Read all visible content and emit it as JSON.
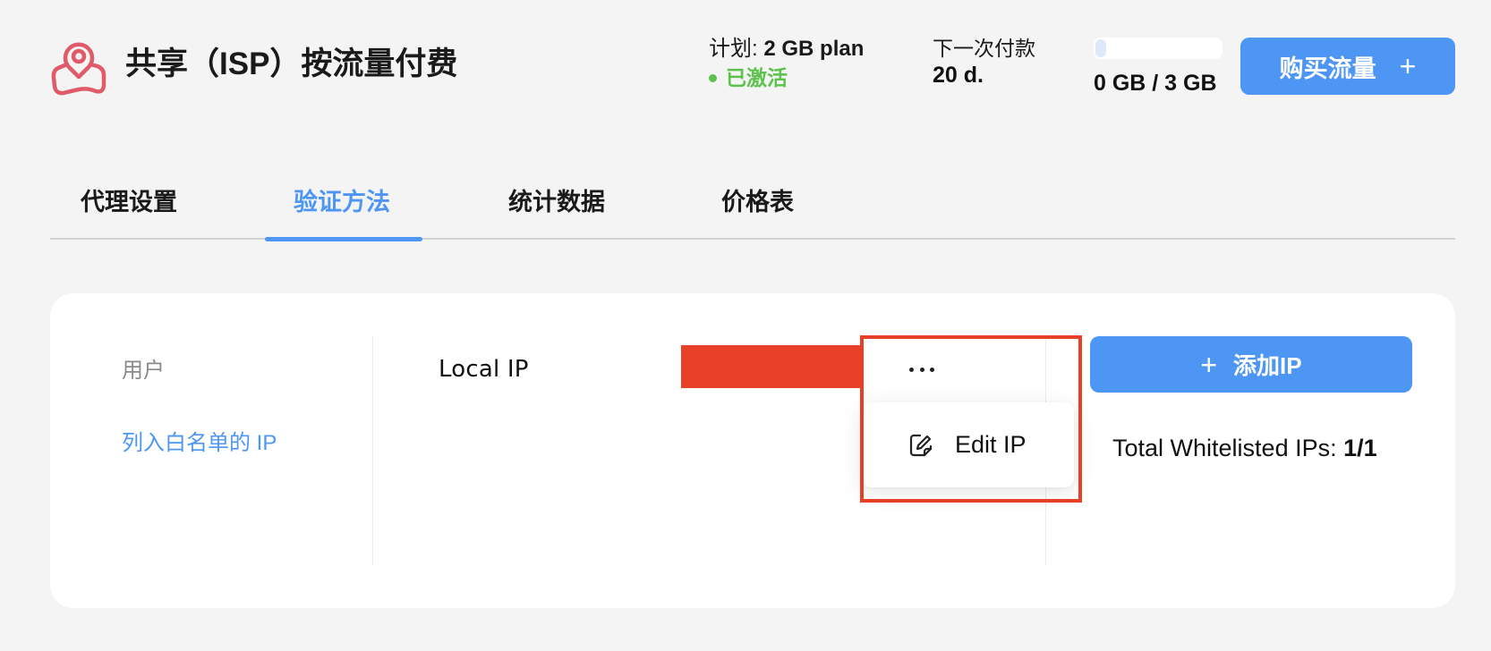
{
  "header": {
    "title": "共享（ISP）按流量付费",
    "logo_icon": "location-pin-map-icon",
    "plan_label": "计划:",
    "plan_value": "2 GB plan",
    "plan_status": "已激活",
    "next_payment_label": "下一次付款",
    "next_payment_value": "20 d.",
    "usage_text": "0 GB / 3 GB",
    "usage_used_gb": 0,
    "usage_total_gb": 3,
    "usage_fraction": 0.0,
    "buy_button_label": "购买流量",
    "buy_button_icon": "plus-icon"
  },
  "tabs": [
    {
      "label": "代理设置",
      "active": false
    },
    {
      "label": "验证方法",
      "active": true
    },
    {
      "label": "统计数据",
      "active": false
    },
    {
      "label": "价格表",
      "active": false
    }
  ],
  "sidebar": {
    "items": [
      {
        "label": "用户",
        "active": false
      },
      {
        "label": "列入白名单的 IP",
        "active": true
      }
    ]
  },
  "ip_list": {
    "items": [
      {
        "name": "Local IP",
        "ip_redacted": true
      }
    ],
    "more_icon": "ellipsis-icon"
  },
  "context_menu": {
    "items": [
      {
        "label": "Edit IP",
        "icon": "edit-icon"
      }
    ]
  },
  "actions": {
    "add_ip_label": "添加IP",
    "add_ip_icon": "plus-icon",
    "total_label": "Total Whitelisted IPs:",
    "total_value": "1/1"
  },
  "colors": {
    "accent": "#4d96f4",
    "active_status": "#5dc24b",
    "logo": "#e05a6a",
    "highlight": "#e84027"
  }
}
